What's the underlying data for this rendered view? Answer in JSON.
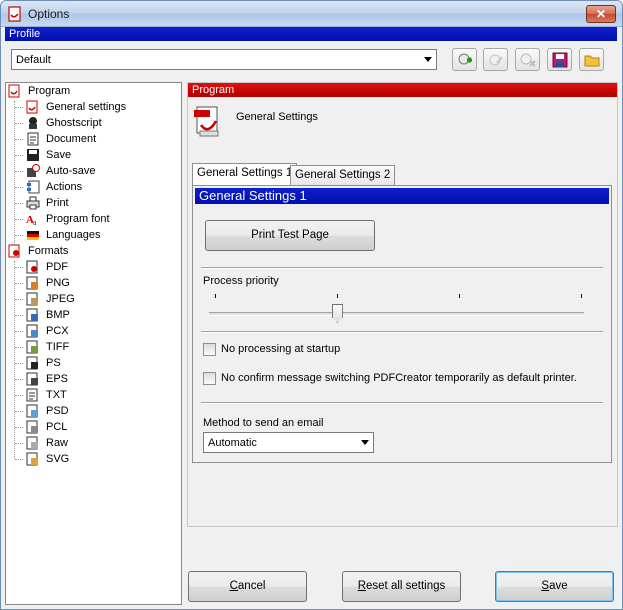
{
  "window": {
    "title": "Options",
    "close_label": "✕"
  },
  "profile": {
    "band_label": "Profile",
    "selected": "Default",
    "toolbar": [
      "add-profile-icon",
      "rename-profile-icon",
      "delete-profile-icon",
      "save-profile-icon",
      "load-profile-icon"
    ]
  },
  "tree": {
    "program": {
      "label": "Program",
      "items": [
        {
          "label": "General settings",
          "icon": "settings-icon"
        },
        {
          "label": "Ghostscript",
          "icon": "ghost-icon"
        },
        {
          "label": "Document",
          "icon": "document-icon"
        },
        {
          "label": "Save",
          "icon": "floppy-icon"
        },
        {
          "label": "Auto-save",
          "icon": "autosave-icon"
        },
        {
          "label": "Actions",
          "icon": "actions-icon"
        },
        {
          "label": "Print",
          "icon": "printer-icon"
        },
        {
          "label": "Program font",
          "icon": "font-icon"
        },
        {
          "label": "Languages",
          "icon": "flag-icon"
        }
      ]
    },
    "formats": {
      "label": "Formats",
      "items": [
        {
          "label": "PDF",
          "icon": "pdf-icon"
        },
        {
          "label": "PNG",
          "icon": "png-icon"
        },
        {
          "label": "JPEG",
          "icon": "jpeg-icon"
        },
        {
          "label": "BMP",
          "icon": "bmp-icon"
        },
        {
          "label": "PCX",
          "icon": "pcx-icon"
        },
        {
          "label": "TIFF",
          "icon": "tiff-icon"
        },
        {
          "label": "PS",
          "icon": "ps-icon"
        },
        {
          "label": "EPS",
          "icon": "eps-icon"
        },
        {
          "label": "TXT",
          "icon": "txt-icon"
        },
        {
          "label": "PSD",
          "icon": "psd-icon"
        },
        {
          "label": "PCL",
          "icon": "pcl-icon"
        },
        {
          "label": "Raw",
          "icon": "raw-icon"
        },
        {
          "label": "SVG",
          "icon": "svg-icon"
        }
      ]
    }
  },
  "panel": {
    "band_label": "Program",
    "heading": "General Settings",
    "tabs": [
      {
        "label": "General Settings 1",
        "active": true
      },
      {
        "label": "General Settings 2",
        "active": false
      }
    ],
    "page_title": "General Settings 1",
    "print_test_page": "Print Test Page",
    "process_priority_label": "Process priority",
    "priority_level": 0.333,
    "no_processing_label": "No processing at startup",
    "no_processing_checked": false,
    "no_confirm_label": "No confirm message switching PDFCreator temporarily as default printer.",
    "no_confirm_checked": false,
    "email_method_label": "Method to send an email",
    "email_method_value": "Automatic"
  },
  "buttons": {
    "cancel": "Cancel",
    "reset": "Reset all settings",
    "save": "Save"
  },
  "colors": {
    "blue_band": "#0010b0",
    "red_band": "#c00000"
  }
}
